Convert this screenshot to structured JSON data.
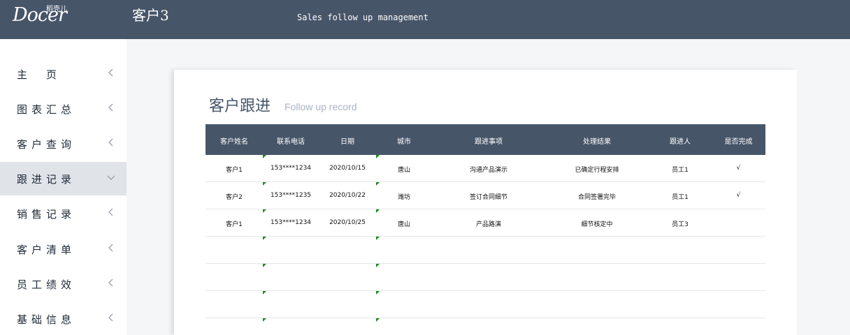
{
  "header": {
    "logo_main": "Docer",
    "logo_sub": "稻壳儿",
    "title": "客户3",
    "subtitle": "Sales follow up management",
    "bg_color": "#475569"
  },
  "sidebar": {
    "items": [
      {
        "label": "主页",
        "chevron": "left",
        "active": false
      },
      {
        "label": "图表汇总",
        "chevron": "left",
        "active": false
      },
      {
        "label": "客户查询",
        "chevron": "left",
        "active": false
      },
      {
        "label": "跟进记录",
        "chevron": "down",
        "active": true
      },
      {
        "label": "销售记录",
        "chevron": "left",
        "active": false
      },
      {
        "label": "客户清单",
        "chevron": "left",
        "active": false
      },
      {
        "label": "员工绩效",
        "chevron": "left",
        "active": false
      },
      {
        "label": "基础信息",
        "chevron": "left",
        "active": false
      }
    ]
  },
  "card": {
    "title": "客户跟进",
    "subtitle": "Follow up record"
  },
  "table": {
    "columns": [
      "客户姓名",
      "联系电话",
      "日期",
      "城市",
      "跟进事项",
      "处理结果",
      "跟进人",
      "是否完成"
    ],
    "rows": [
      [
        "客户1",
        "153****1234",
        "2020/10/15",
        "唐山",
        "沟通产品演示",
        "已确定行程安排",
        "员工1",
        "√"
      ],
      [
        "客户2",
        "153****1235",
        "2020/10/22",
        "潍坊",
        "签订合同细节",
        "合同签署完毕",
        "员工1",
        "√"
      ],
      [
        "客户1",
        "153****1234",
        "2020/10/25",
        "唐山",
        "产品路演",
        "细节核定中",
        "员工3",
        ""
      ],
      [
        "",
        "",
        "",
        "",
        "",
        "",
        "",
        ""
      ],
      [
        "",
        "",
        "",
        "",
        "",
        "",
        "",
        ""
      ],
      [
        "",
        "",
        "",
        "",
        "",
        "",
        "",
        ""
      ],
      [
        "",
        "",
        "",
        "",
        "",
        "",
        "",
        ""
      ]
    ],
    "header_color": "#475569",
    "marker_color": "#1a8a1a"
  }
}
